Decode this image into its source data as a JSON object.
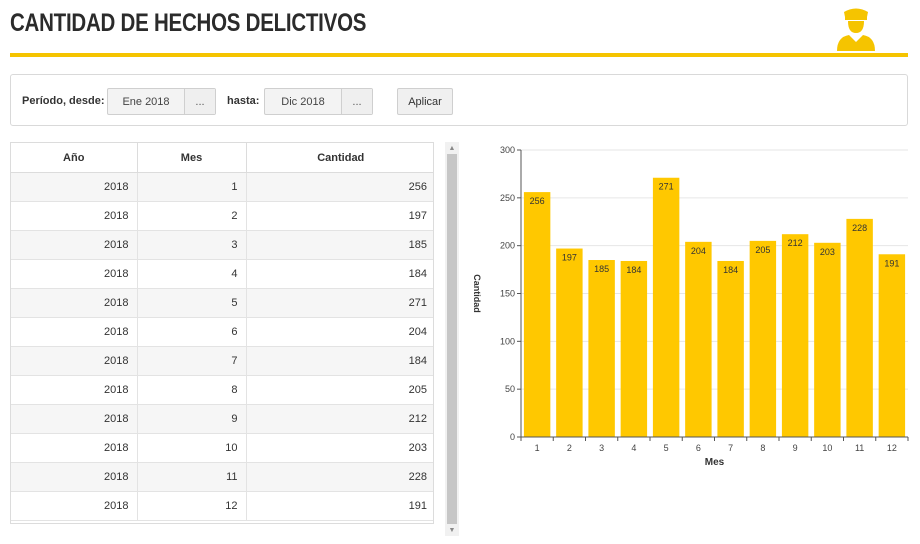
{
  "header": {
    "title": "CANTIDAD DE HECHOS DELICTIVOS",
    "icon": "police-officer-icon",
    "accent_color": "#f5c400"
  },
  "filters": {
    "from_label": "Período, desde:",
    "from_value": "Ene 2018",
    "from_picker": "...",
    "to_label": "hasta:",
    "to_value": "Dic 2018",
    "to_picker": "...",
    "apply_label": "Aplicar"
  },
  "table": {
    "headers": [
      "Año",
      "Mes",
      "Cantidad"
    ],
    "rows": [
      [
        "2018",
        "1",
        "256"
      ],
      [
        "2018",
        "2",
        "197"
      ],
      [
        "2018",
        "3",
        "185"
      ],
      [
        "2018",
        "4",
        "184"
      ],
      [
        "2018",
        "5",
        "271"
      ],
      [
        "2018",
        "6",
        "204"
      ],
      [
        "2018",
        "7",
        "184"
      ],
      [
        "2018",
        "8",
        "205"
      ],
      [
        "2018",
        "9",
        "212"
      ],
      [
        "2018",
        "10",
        "203"
      ],
      [
        "2018",
        "11",
        "228"
      ],
      [
        "2018",
        "12",
        "191"
      ]
    ]
  },
  "chart_data": {
    "type": "bar",
    "categories": [
      "1",
      "2",
      "3",
      "4",
      "5",
      "6",
      "7",
      "8",
      "9",
      "10",
      "11",
      "12"
    ],
    "values": [
      256,
      197,
      185,
      184,
      271,
      204,
      184,
      205,
      212,
      203,
      228,
      191
    ],
    "xlabel": "Mes",
    "ylabel": "Cantidad",
    "ylim": [
      0,
      300
    ],
    "yticks": [
      0,
      50,
      100,
      150,
      200,
      250,
      300
    ],
    "grid": true,
    "bar_color": "#ffc800",
    "data_labels": true
  }
}
